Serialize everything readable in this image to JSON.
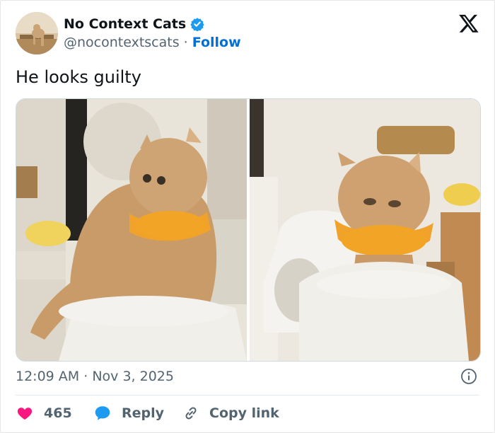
{
  "account": {
    "display_name": "No Context Cats",
    "handle": "@nocontextscats",
    "separator": "·",
    "follow_label": "Follow"
  },
  "tweet": {
    "text": "He looks guilty",
    "time": "12:09 AM",
    "separator": "·",
    "date": "Nov 3, 2025"
  },
  "actions": {
    "like_count": "465",
    "reply_label": "Reply",
    "copy_link_label": "Copy link"
  },
  "icons": [
    "x-logo-icon",
    "verified-badge-icon",
    "info-icon",
    "heart-icon",
    "reply-bubble-icon",
    "link-icon"
  ],
  "colors": {
    "follow_link": "#006fd6",
    "verified": "#1d9bf0",
    "heart": "#f91880",
    "reply_bubble": "#1d9bf0",
    "secondary_text": "#536471"
  }
}
